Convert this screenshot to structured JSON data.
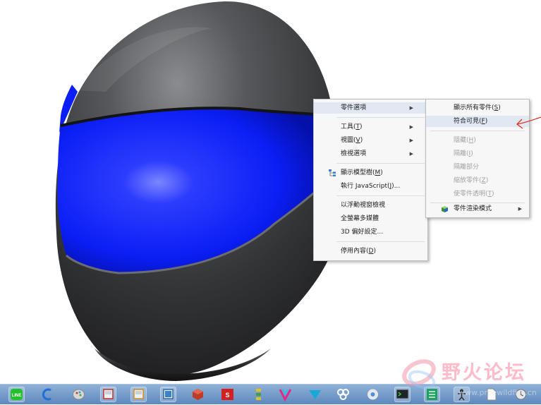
{
  "context_menu": {
    "items": [
      {
        "label": "零件選項",
        "accel": "",
        "suffix": "",
        "submenu": true,
        "highlighted": true
      },
      {
        "label": "工具",
        "accel": "T",
        "suffix": "",
        "submenu": true
      },
      {
        "label": "視圖",
        "accel": "V",
        "suffix": "",
        "submenu": true
      },
      {
        "label": "檢視選項",
        "accel": "",
        "suffix": "",
        "submenu": true
      },
      {
        "label": "顯示模型樹",
        "accel": "M",
        "suffix": "",
        "submenu": false,
        "icon": "model-tree-icon"
      },
      {
        "label": "執行 JavaScript",
        "accel": "J",
        "suffix": "...",
        "submenu": false
      },
      {
        "label": "以浮動視窗檢視",
        "accel": "",
        "suffix": "",
        "submenu": false
      },
      {
        "label": "全螢幕多媒體",
        "accel": "",
        "suffix": "",
        "submenu": false
      },
      {
        "label": "3D 偏好設定",
        "accel": "",
        "suffix": "...",
        "submenu": false
      },
      {
        "label": "停用內容",
        "accel": "D",
        "suffix": "",
        "submenu": false
      }
    ]
  },
  "part_options_submenu": {
    "items": [
      {
        "label": "顯示所有零件",
        "accel": "S",
        "enabled": true
      },
      {
        "label": "符合可見",
        "accel": "F",
        "enabled": true,
        "highlighted": true
      },
      {
        "label": "隱藏",
        "accel": "H",
        "enabled": false
      },
      {
        "label": "隔離",
        "accel": "I",
        "enabled": false
      },
      {
        "label": "隔離部分",
        "accel": "",
        "enabled": false
      },
      {
        "label": "縮放零件",
        "accel": "Z",
        "enabled": false
      },
      {
        "label": "使零件透明",
        "accel": "T",
        "enabled": false
      },
      {
        "label": "零件渲染模式",
        "accel": "",
        "enabled": true,
        "submenu": true,
        "icon": "render-mode-icon"
      }
    ]
  },
  "watermark": {
    "text": "野火论坛",
    "url": "www.proewildfire.cn"
  },
  "taskbar": {
    "icons": [
      "line-icon",
      "browser-icon",
      "paint-icon",
      "window-icon",
      "window-icon",
      "window-icon",
      "cube-icon",
      "solidworks-icon",
      "layers-icon",
      "logo-icon",
      "send-icon",
      "network-icon",
      "chrome-icon",
      "terminal-icon",
      "sheet-icon",
      "figure-icon",
      "document-icon",
      "clock-icon"
    ]
  },
  "colors": {
    "helmet_shell": "#3a3b3d",
    "visor_band": "#0b1ef5",
    "menu_highlight": "#dfe8f3",
    "annotation": "#e0301f"
  }
}
